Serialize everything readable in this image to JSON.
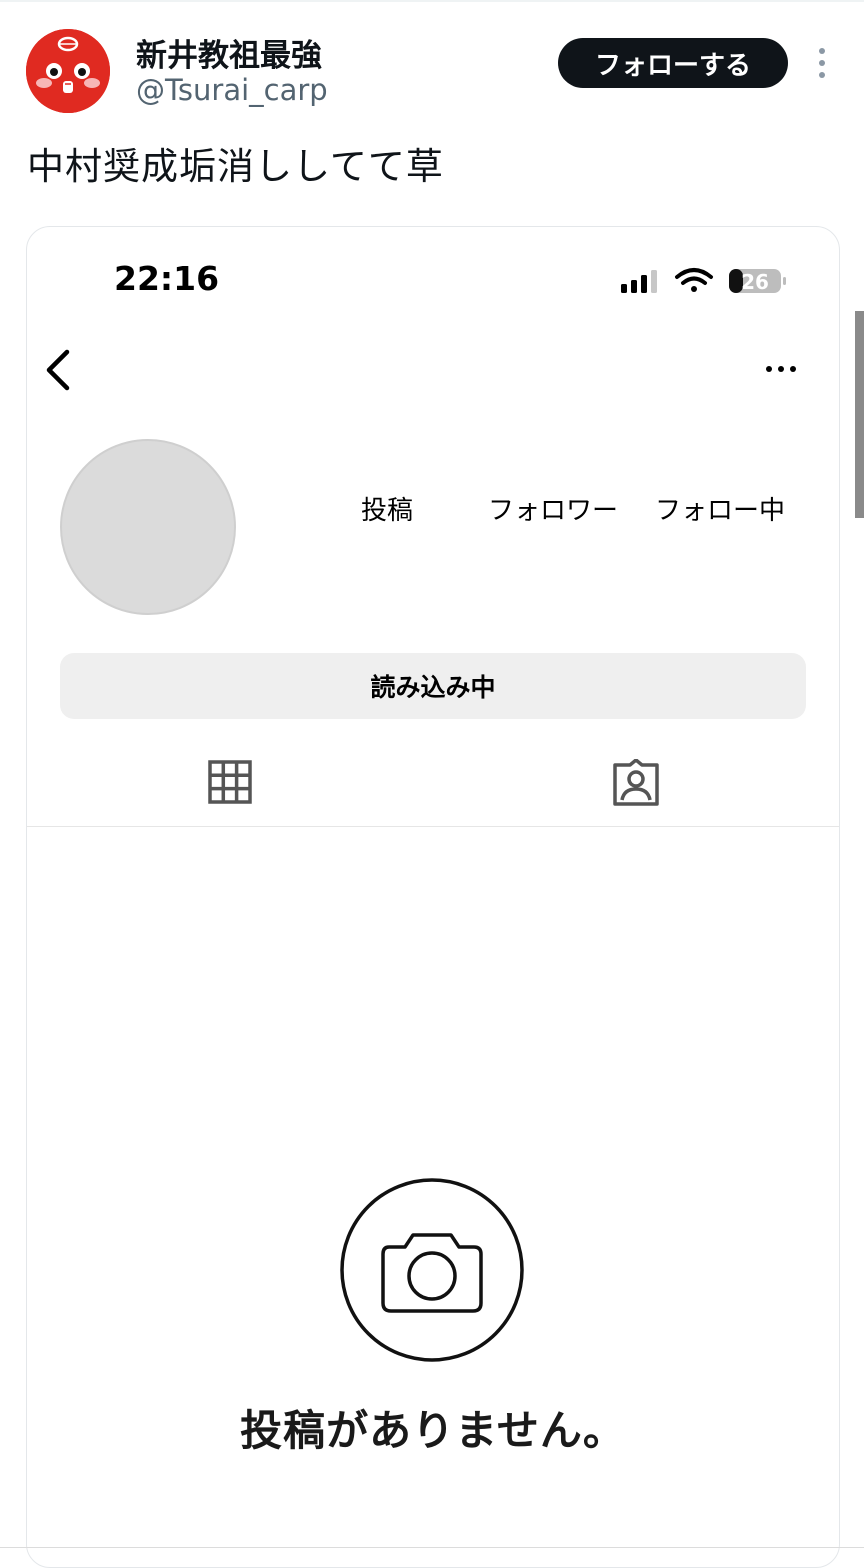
{
  "tweet": {
    "author_name": "新井教祖最強",
    "handle": "@Tsurai_carp",
    "follow_label": "フォローする",
    "text": "中村奨成垢消ししてて草",
    "avatar_icon": "red-character-avatar",
    "more_icon": "vertical-dots-icon"
  },
  "screenshot": {
    "status_bar": {
      "time": "22:16",
      "battery": "26"
    },
    "profile": {
      "stats": [
        {
          "label": "投稿"
        },
        {
          "label": "フォロワー"
        },
        {
          "label": "フォロー中"
        }
      ],
      "loading_button": "読み込み中"
    },
    "tabs": [
      {
        "icon": "grid-icon"
      },
      {
        "icon": "tagged-person-icon"
      }
    ],
    "empty_state": {
      "icon": "camera-icon",
      "text": "投稿がありません。"
    }
  },
  "colors": {
    "follow_bg": "#0f1419",
    "avatar_red": "#e02a21",
    "handle_gray": "#536471"
  }
}
